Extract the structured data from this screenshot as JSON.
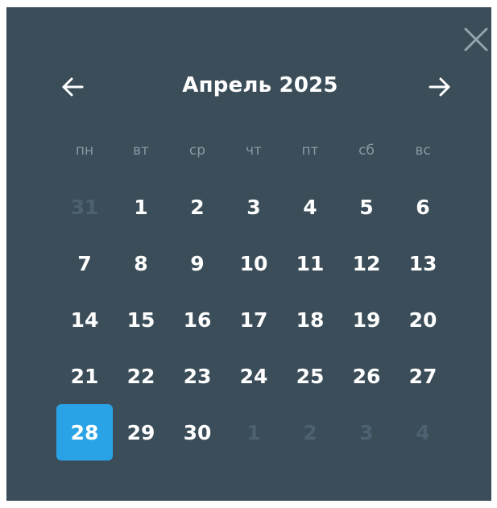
{
  "calendar": {
    "title": "Апрель 2025",
    "weekdays": [
      "пн",
      "вт",
      "ср",
      "чт",
      "пт",
      "сб",
      "вс"
    ],
    "weeks": [
      [
        {
          "d": "31",
          "out": true
        },
        {
          "d": "1"
        },
        {
          "d": "2"
        },
        {
          "d": "3"
        },
        {
          "d": "4"
        },
        {
          "d": "5"
        },
        {
          "d": "6"
        }
      ],
      [
        {
          "d": "7"
        },
        {
          "d": "8"
        },
        {
          "d": "9"
        },
        {
          "d": "10"
        },
        {
          "d": "11"
        },
        {
          "d": "12"
        },
        {
          "d": "13"
        }
      ],
      [
        {
          "d": "14"
        },
        {
          "d": "15"
        },
        {
          "d": "16"
        },
        {
          "d": "17"
        },
        {
          "d": "18"
        },
        {
          "d": "19"
        },
        {
          "d": "20"
        }
      ],
      [
        {
          "d": "21"
        },
        {
          "d": "22"
        },
        {
          "d": "23"
        },
        {
          "d": "24"
        },
        {
          "d": "25"
        },
        {
          "d": "26"
        },
        {
          "d": "27"
        }
      ],
      [
        {
          "d": "28",
          "selected": true
        },
        {
          "d": "29"
        },
        {
          "d": "30"
        },
        {
          "d": "1",
          "out": true
        },
        {
          "d": "2",
          "out": true
        },
        {
          "d": "3",
          "out": true
        },
        {
          "d": "4",
          "out": true
        }
      ]
    ],
    "icons": {
      "close": "close-icon",
      "prev": "arrow-left-icon",
      "next": "arrow-right-icon"
    },
    "colors": {
      "background": "#3a4d59",
      "text": "#ffffff",
      "weekday": "#8a9aa5",
      "out_of_month": "#4e6170",
      "selected": "#2aa3e6",
      "close_icon": "#94a3ad"
    }
  }
}
